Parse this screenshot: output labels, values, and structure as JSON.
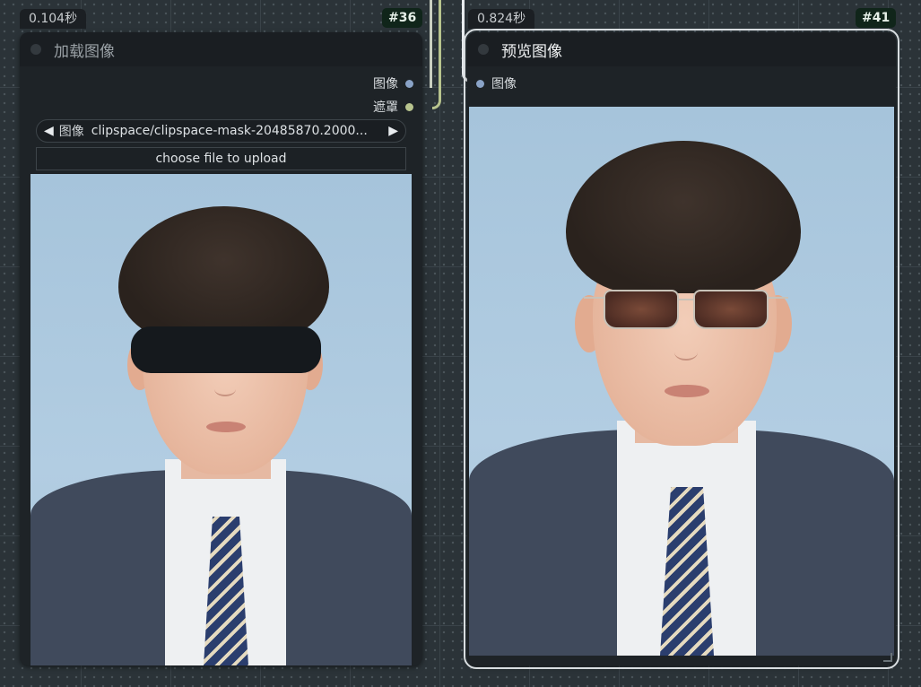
{
  "nodes": {
    "load_image": {
      "timing": "0.104秒",
      "id_badge": "#36",
      "title": "加载图像",
      "outputs": [
        {
          "label": "图像",
          "color": "#8aa3c7"
        },
        {
          "label": "遮罩",
          "color": "#b8c48e"
        }
      ],
      "image_widget": {
        "label": "图像",
        "value": "clipspace/clipspace-mask-20485870.2000...",
        "prev_arrow": "◀",
        "next_arrow": "▶"
      },
      "upload_button": "choose file to upload"
    },
    "preview_image": {
      "timing": "0.824秒",
      "id_badge": "#41",
      "title": "预览图像",
      "inputs": [
        {
          "label": "图像",
          "color": "#8aa3c7"
        }
      ]
    }
  }
}
